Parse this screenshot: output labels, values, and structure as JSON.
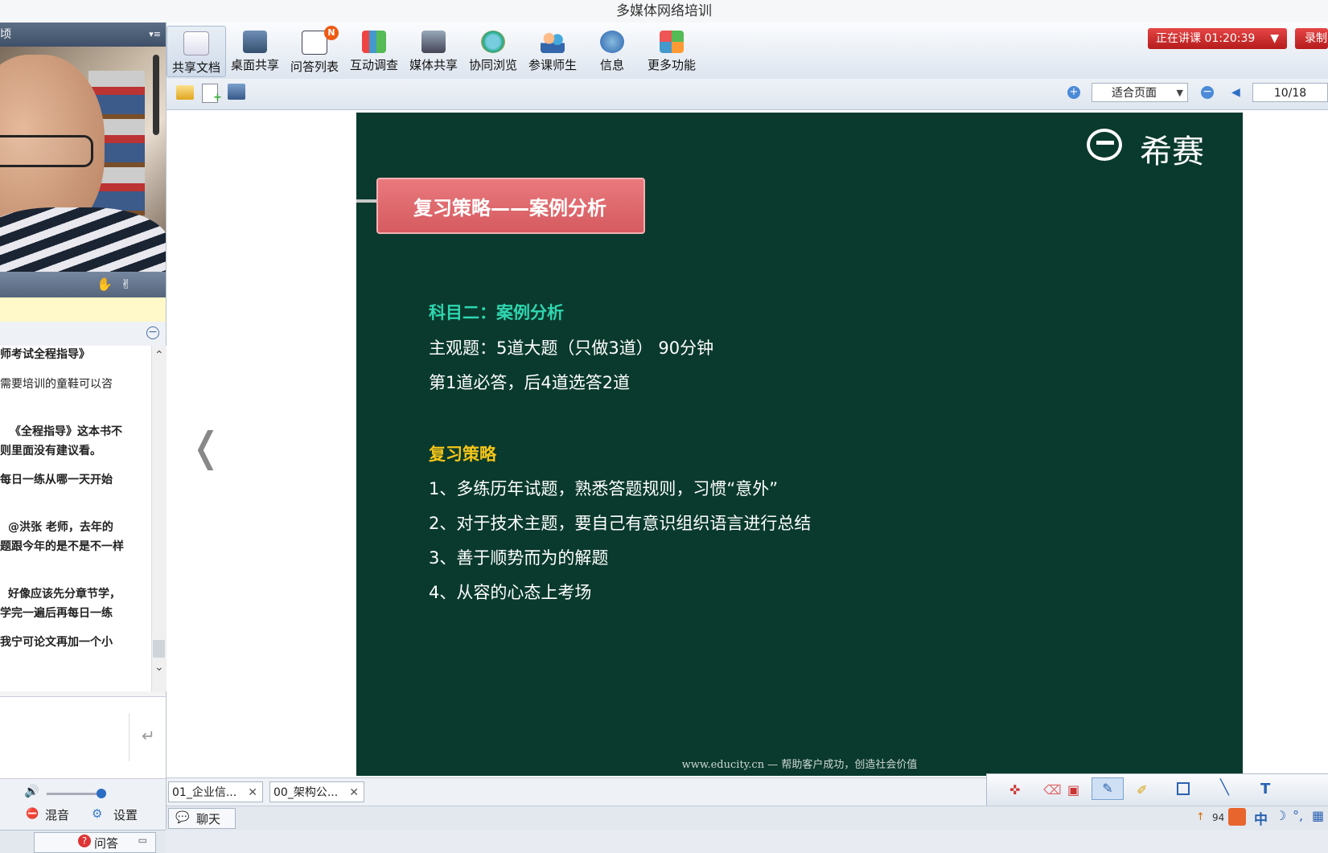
{
  "window": {
    "title": "多媒体网络培训"
  },
  "left_panel": {
    "header_title": "顷",
    "chat_messages": [
      "师考试全程指导》",
      "需要培训的童鞋可以咨",
      "《全程指导》这本书不",
      "则里面没有建议看。",
      "每日一练从哪一天开始",
      "@洪张  老师，去年的",
      "题跟今年的是不是不一样",
      "好像应该先分章节学，",
      "学完一遍后再每日一练",
      "我宁可论文再加一个小"
    ],
    "mix_label": "混音",
    "settings_label": "设置",
    "qa_label": "问答"
  },
  "toolbar": {
    "items": [
      {
        "label": "共享文档",
        "icon": "document-share-icon"
      },
      {
        "label": "桌面共享",
        "icon": "desktop-share-icon"
      },
      {
        "label": "问答列表",
        "icon": "qa-list-icon",
        "badge": "N"
      },
      {
        "label": "互动调查",
        "icon": "survey-chart-icon"
      },
      {
        "label": "媒体共享",
        "icon": "media-share-icon"
      },
      {
        "label": "协同浏览",
        "icon": "browser-ie-icon"
      },
      {
        "label": "参课师生",
        "icon": "participants-icon"
      },
      {
        "label": "信息",
        "icon": "info-icon"
      },
      {
        "label": "更多功能",
        "icon": "more-grid-icon"
      }
    ],
    "live_status": "正在讲课  01:20:39",
    "record_label": "录制"
  },
  "view": {
    "zoom_option": "适合页面",
    "page_indicator": "10/18"
  },
  "slide": {
    "logo_text": "希赛",
    "banner": "复习策略——案例分析",
    "subject_heading": "科目二：案例分析",
    "line1": "主观题：5道大题（只做3道）  90分钟",
    "line2": "第1道必答，后4道选答2道",
    "strategy_heading": "复习策略",
    "points": [
      "1、多练历年试题，熟悉答题规则，习惯“意外”",
      "2、对于技术主题，要自己有意识组织语言进行总结",
      "3、善于顺势而为的解题",
      "4、从容的心态上考场"
    ],
    "footer": "www.educity.cn  —  帮助客户成功，创造社会价值",
    "prev_arrow": "❬"
  },
  "doc_tabs": [
    {
      "label": "01_企业信..."
    },
    {
      "label": "00_架构公..."
    }
  ],
  "chat_tab": {
    "label": "聊天"
  },
  "ime": {
    "label": "中",
    "count": "94"
  },
  "colors": {
    "slide_bg": "#0a3a2d",
    "banner": "#e06a6f",
    "heading_cyan": "#2fd6b0",
    "heading_yellow": "#f5c518",
    "live_red": "#d42a2a"
  }
}
